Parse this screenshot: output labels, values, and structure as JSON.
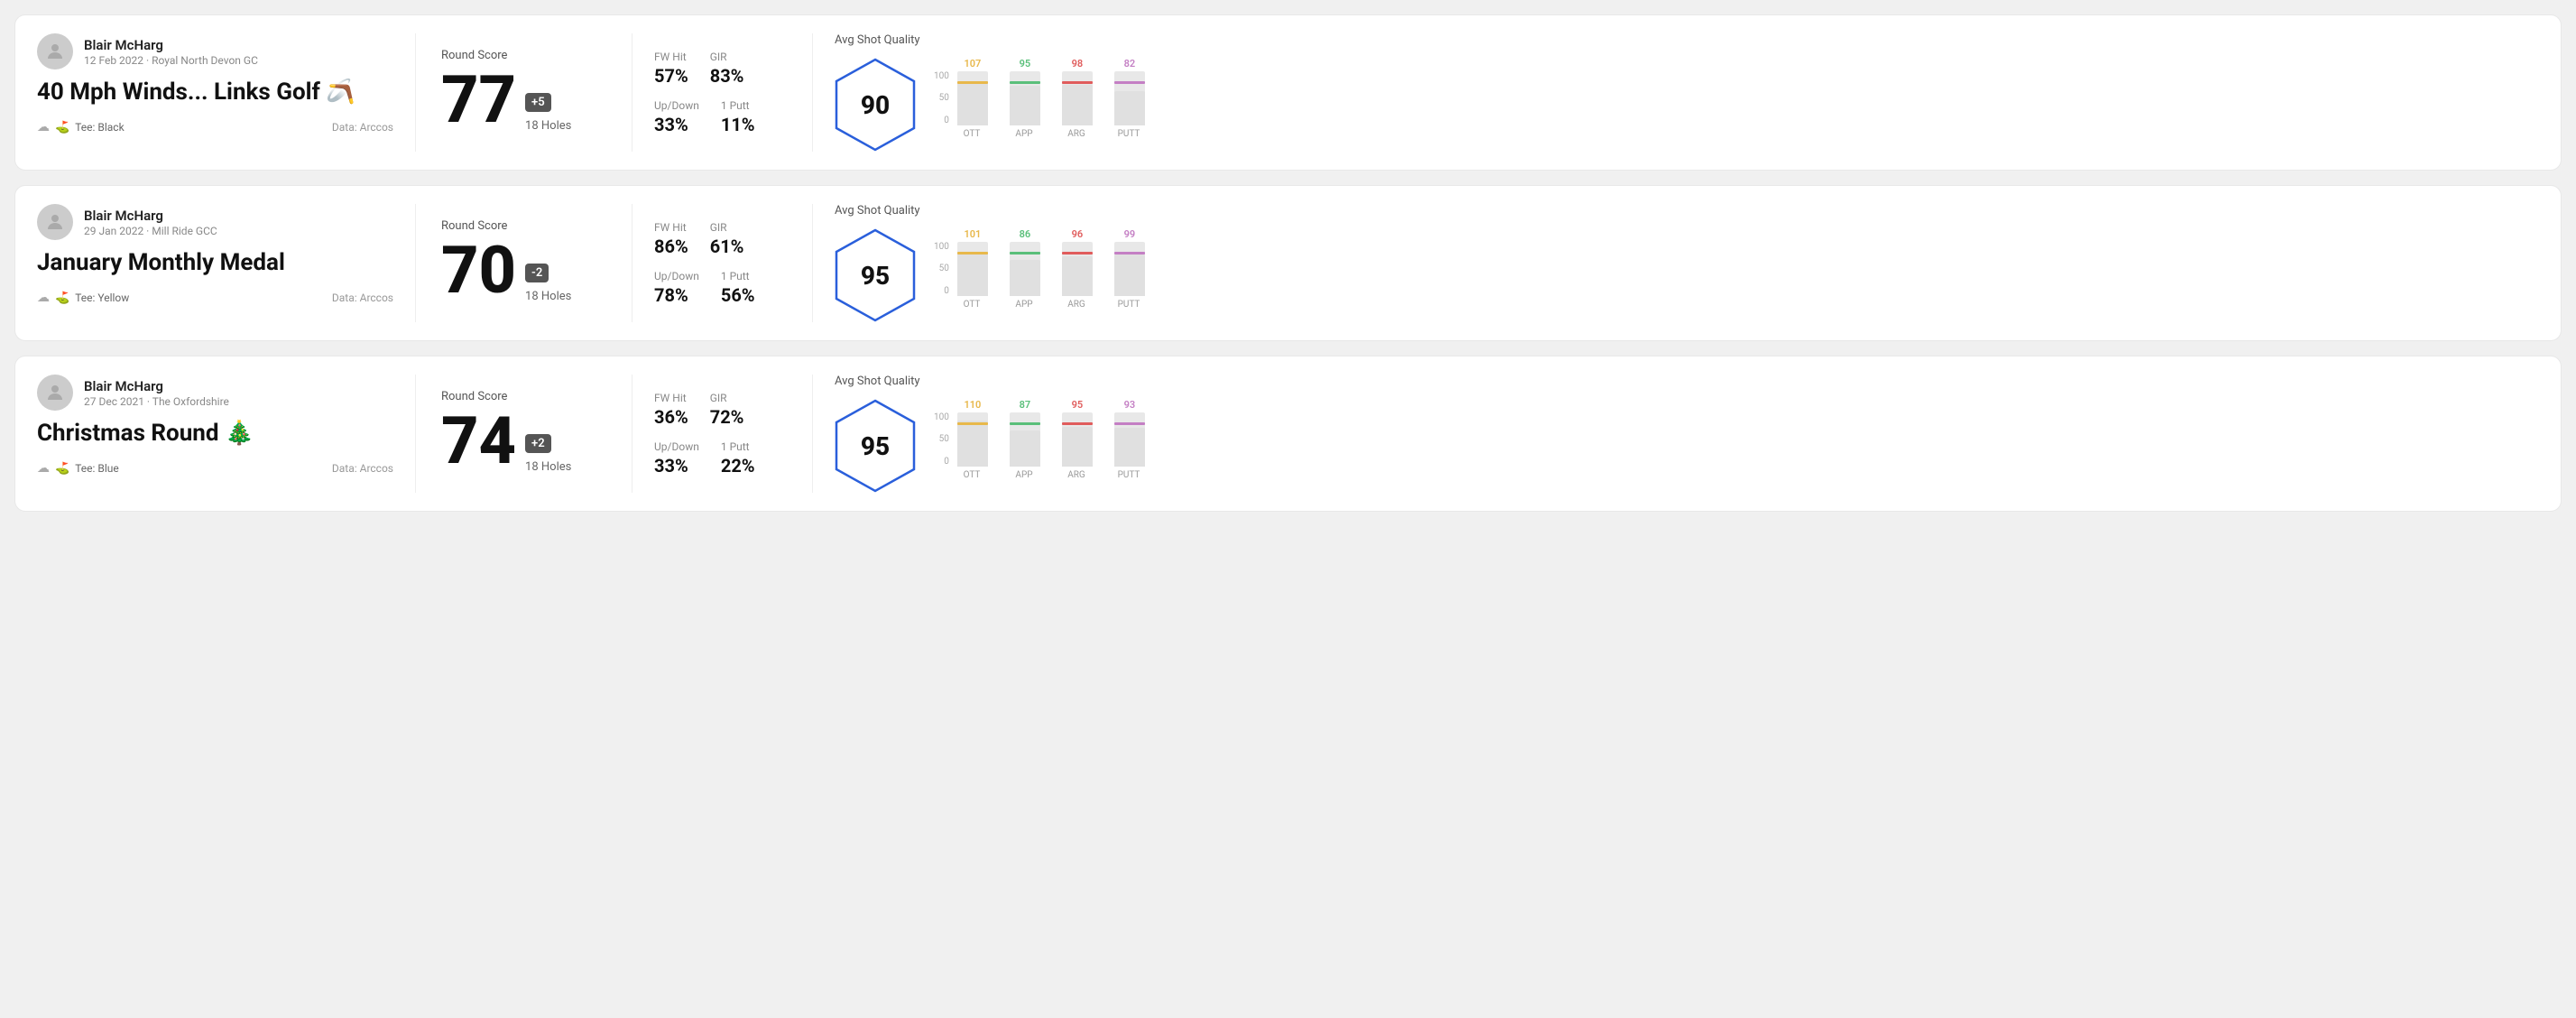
{
  "rounds": [
    {
      "id": 1,
      "user": "Blair McHarg",
      "date_course": "12 Feb 2022 · Royal North Devon GC",
      "title": "40 Mph Winds... Links Golf 🪃",
      "tee": "Black",
      "data_source": "Data: Arccos",
      "round_score_label": "Round Score",
      "score": "77",
      "score_diff": "+5",
      "holes": "18 Holes",
      "fw_hit_label": "FW Hit",
      "fw_hit": "57%",
      "gir_label": "GIR",
      "gir": "83%",
      "updown_label": "Up/Down",
      "updown": "33%",
      "oneputt_label": "1 Putt",
      "oneputt": "11%",
      "avg_shot_quality_label": "Avg Shot Quality",
      "quality_score": "90",
      "bars": [
        {
          "label": "OTT",
          "value": 107,
          "color": "#e8b84b"
        },
        {
          "label": "APP",
          "value": 95,
          "color": "#5abf7a"
        },
        {
          "label": "ARG",
          "value": 98,
          "color": "#e05c5c"
        },
        {
          "label": "PUTT",
          "value": 82,
          "color": "#c47fc4"
        }
      ],
      "chart_max": 100
    },
    {
      "id": 2,
      "user": "Blair McHarg",
      "date_course": "29 Jan 2022 · Mill Ride GCC",
      "title": "January Monthly Medal",
      "tee": "Yellow",
      "data_source": "Data: Arccos",
      "round_score_label": "Round Score",
      "score": "70",
      "score_diff": "-2",
      "holes": "18 Holes",
      "fw_hit_label": "FW Hit",
      "fw_hit": "86%",
      "gir_label": "GIR",
      "gir": "61%",
      "updown_label": "Up/Down",
      "updown": "78%",
      "oneputt_label": "1 Putt",
      "oneputt": "56%",
      "avg_shot_quality_label": "Avg Shot Quality",
      "quality_score": "95",
      "bars": [
        {
          "label": "OTT",
          "value": 101,
          "color": "#e8b84b"
        },
        {
          "label": "APP",
          "value": 86,
          "color": "#5abf7a"
        },
        {
          "label": "ARG",
          "value": 96,
          "color": "#e05c5c"
        },
        {
          "label": "PUTT",
          "value": 99,
          "color": "#c47fc4"
        }
      ],
      "chart_max": 100
    },
    {
      "id": 3,
      "user": "Blair McHarg",
      "date_course": "27 Dec 2021 · The Oxfordshire",
      "title": "Christmas Round 🎄",
      "tee": "Blue",
      "data_source": "Data: Arccos",
      "round_score_label": "Round Score",
      "score": "74",
      "score_diff": "+2",
      "holes": "18 Holes",
      "fw_hit_label": "FW Hit",
      "fw_hit": "36%",
      "gir_label": "GIR",
      "gir": "72%",
      "updown_label": "Up/Down",
      "updown": "33%",
      "oneputt_label": "1 Putt",
      "oneputt": "22%",
      "avg_shot_quality_label": "Avg Shot Quality",
      "quality_score": "95",
      "bars": [
        {
          "label": "OTT",
          "value": 110,
          "color": "#e8b84b"
        },
        {
          "label": "APP",
          "value": 87,
          "color": "#5abf7a"
        },
        {
          "label": "ARG",
          "value": 95,
          "color": "#e05c5c"
        },
        {
          "label": "PUTT",
          "value": 93,
          "color": "#c47fc4"
        }
      ],
      "chart_max": 100
    }
  ]
}
